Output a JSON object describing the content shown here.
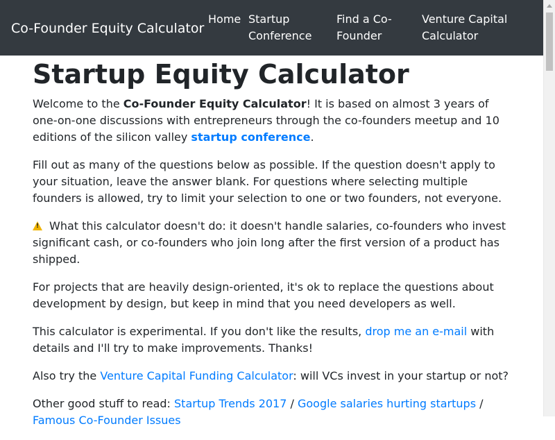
{
  "navbar": {
    "brand": "Co-Founder Equity Calculator",
    "links": [
      {
        "line1": "Home",
        "line2": ""
      },
      {
        "line1": "Startup",
        "line2": "Conference"
      },
      {
        "line1": "Find a Co-",
        "line2": "Founder"
      },
      {
        "line1": "Venture Capital",
        "line2": "Calculator"
      }
    ]
  },
  "main": {
    "title": "Startup Equity Calculator",
    "intro": {
      "pre": "Welcome to the ",
      "bold": "Co-Founder Equity Calculator",
      "mid": "! It is based on almost 3 years of one-on-one discussions with entrepreneurs through the co-founders meetup and 10 editions of the silicon valley ",
      "link": "startup conference",
      "post": "."
    },
    "fill_out": "Fill out as many of the questions below as possible. If the question doesn't apply to your situation, leave the answer blank. For questions where selecting multiple founders is allowed, try to limit your selection to one or two founders, not everyone.",
    "warning": "What this calculator doesn't do: it doesn't handle salaries, co-founders who invest significant cash, or co-founders who join long after the first version of a product has shipped.",
    "design": "For projects that are heavily design-oriented, it's ok to replace the questions about development by design, but keep in mind that you need developers as well.",
    "experimental": {
      "pre": "This calculator is experimental. If you don't like the results, ",
      "link": "drop me an e-mail",
      "post": " with details and I'll try to make improvements. Thanks!"
    },
    "also_try": {
      "pre": "Also try the ",
      "link": "Venture Capital Funding Calculator",
      "post": ": will VCs invest in your startup or not?"
    },
    "other": {
      "pre": "Other good stuff to read: ",
      "link1": "Startup Trends 2017",
      "sep1": " / ",
      "link2": "Google salaries hurting startups",
      "sep2": " / ",
      "link3": "Famous Co-Founder Issues"
    }
  },
  "icons": {
    "warning": "warning-icon"
  },
  "colors": {
    "navbar_bg": "#343a40",
    "link": "#007bff",
    "text": "#212529"
  }
}
